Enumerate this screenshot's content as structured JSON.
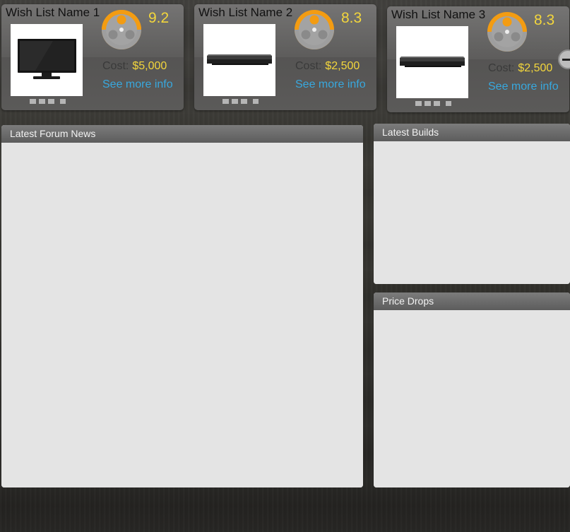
{
  "wishlists": [
    {
      "name": "Wish List Name 1",
      "score": "9.2",
      "cost_label": "Cost:",
      "cost_value": "$5,000",
      "more_label": "See more info",
      "product": "tv"
    },
    {
      "name": "Wish List Name 2",
      "score": "8.3",
      "cost_label": "Cost:",
      "cost_value": "$2,500",
      "more_label": "See more info",
      "product": "blu-ray-player"
    },
    {
      "name": "Wish List Name 3",
      "score": "8.3",
      "cost_label": "Cost:",
      "cost_value": "$2,500",
      "more_label": "See more info",
      "product": "blu-ray-player"
    }
  ],
  "carousel": {
    "next_icon": "arrow-right-icon"
  },
  "panels": {
    "forum_news": {
      "title": "Latest Forum News"
    },
    "builds": {
      "title": "Latest Builds"
    },
    "price_drops": {
      "title": "Price Drops"
    }
  },
  "colors": {
    "score": "#f3d63c",
    "link": "#38a8de",
    "reel": "#f39c12"
  }
}
